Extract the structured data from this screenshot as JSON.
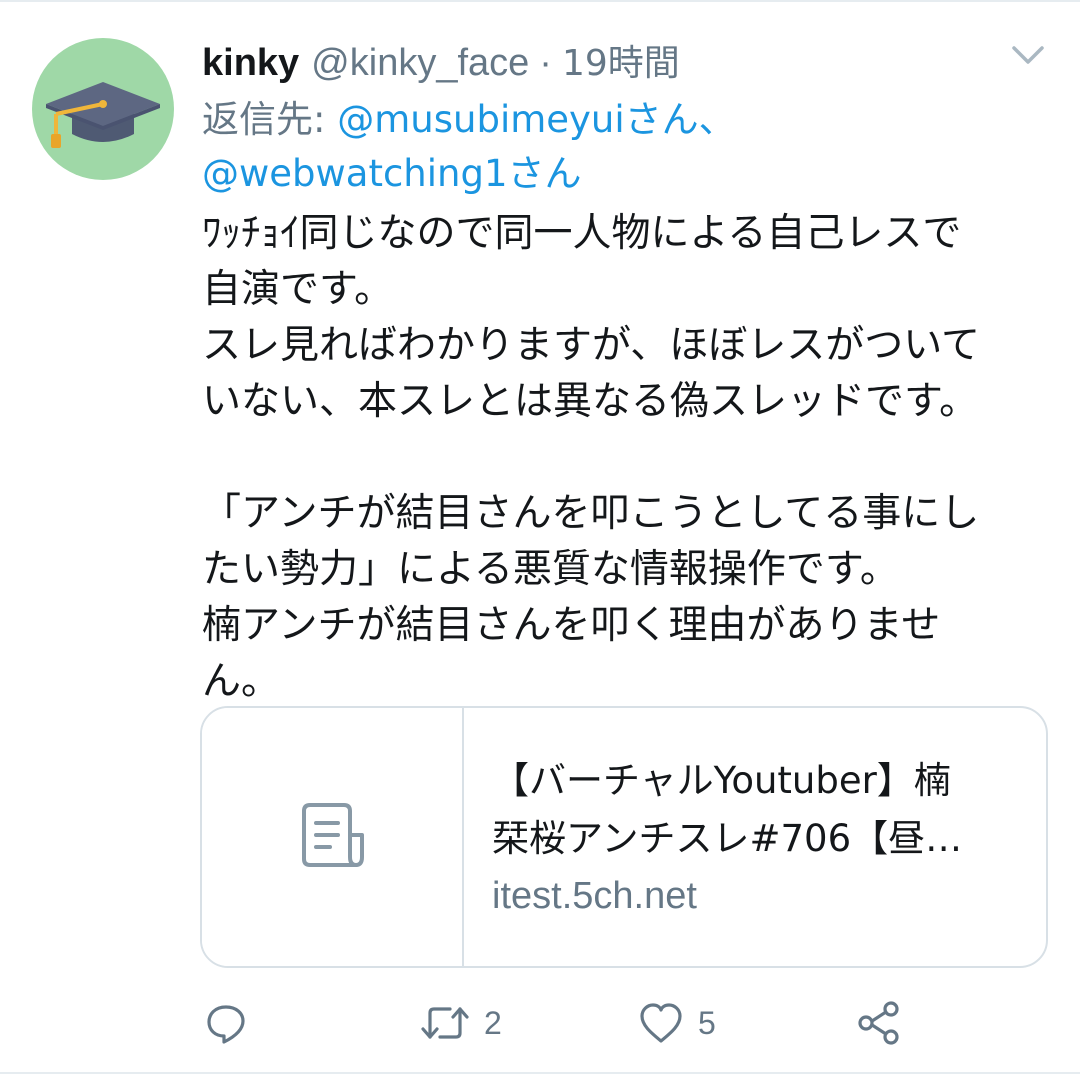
{
  "tweet": {
    "display_name": "kinky",
    "handle": "@kinky_face",
    "separator": "·",
    "time": "19時間",
    "reply_prefix": "返信先: ",
    "reply_to": [
      "@musubimeyuiさん、",
      "@webwatching1さん"
    ],
    "body_lines": [
      "ﾜｯﾁｮｲ同じなので同一人物による自己レスで",
      "自演です。",
      "スレ見ればわかりますが、ほぼレスがついて",
      "いない、本スレとは異なる偽スレッドです。",
      "",
      "「アンチが結目さんを叩こうとしてる事にし",
      "たい勢力」による悪質な情報操作です。",
      "楠アンチが結目さんを叩く理由がありませ",
      "ん。"
    ]
  },
  "link_card": {
    "title_lines": [
      "【バーチャルYoutuber】楠",
      "栞桜アンチスレ#706【昼…"
    ],
    "domain": "itest.5ch.net",
    "thumbnail_icon": "document-icon"
  },
  "actions": {
    "reply_icon": "reply-icon",
    "retweet_icon": "retweet-icon",
    "retweet_count": "2",
    "like_icon": "heart-icon",
    "like_count": "5",
    "share_icon": "share-icon"
  },
  "colors": {
    "text": "#14171a",
    "secondary": "#657786",
    "link": "#1b95e0",
    "border": "#d8e0e6",
    "avatar_bg": "#9fd8a7"
  }
}
